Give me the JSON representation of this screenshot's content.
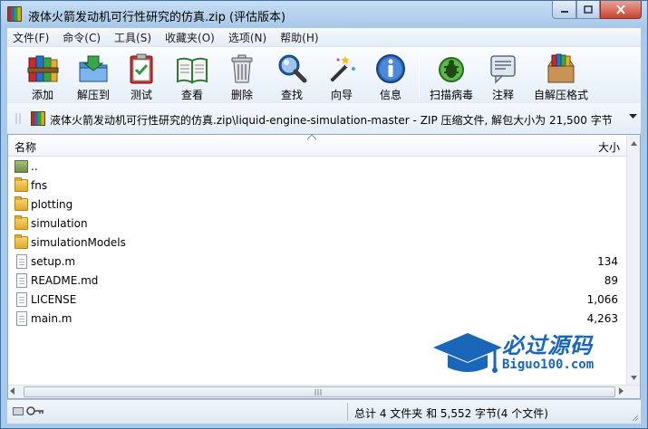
{
  "window": {
    "title": "液体火箭发动机可行性研究的仿真.zip (评估版本)"
  },
  "menu": [
    "文件(F)",
    "命令(C)",
    "工具(S)",
    "收藏夹(O)",
    "选项(N)",
    "帮助(H)"
  ],
  "toolbar": [
    {
      "label": "添加",
      "icon": "books-add-icon"
    },
    {
      "label": "解压到",
      "icon": "folder-extract-icon"
    },
    {
      "label": "测试",
      "icon": "clipboard-check-icon"
    },
    {
      "label": "查看",
      "icon": "book-view-icon"
    },
    {
      "label": "删除",
      "icon": "trash-icon"
    },
    {
      "label": "查找",
      "icon": "magnifier-icon"
    },
    {
      "label": "向导",
      "icon": "wand-icon"
    },
    {
      "label": "信息",
      "icon": "info-icon"
    },
    {
      "label": "扫描病毒",
      "icon": "bug-scan-icon"
    },
    {
      "label": "注释",
      "icon": "comment-icon"
    },
    {
      "label": "自解压格式",
      "icon": "sfx-box-icon"
    }
  ],
  "pathbar": {
    "text": "液体火箭发动机可行性研究的仿真.zip\\liquid-engine-simulation-master - ZIP 压缩文件, 解包大小为 21,500 字节"
  },
  "columns": {
    "name": "名称",
    "size": "大小"
  },
  "files": [
    {
      "name": "..",
      "type": "up",
      "size": ""
    },
    {
      "name": "fns",
      "type": "folder",
      "size": ""
    },
    {
      "name": "plotting",
      "type": "folder",
      "size": ""
    },
    {
      "name": "simulation",
      "type": "folder",
      "size": ""
    },
    {
      "name": "simulationModels",
      "type": "folder",
      "size": ""
    },
    {
      "name": "setup.m",
      "type": "file",
      "size": "134"
    },
    {
      "name": "README.md",
      "type": "file",
      "size": "89"
    },
    {
      "name": "LICENSE",
      "type": "file",
      "size": "1,066"
    },
    {
      "name": "main.m",
      "type": "file",
      "size": "4,263"
    }
  ],
  "status": {
    "summary": "总计 4 文件夹 和 5,552 字节(4 个文件)"
  },
  "watermark": {
    "title": "必过源码",
    "url": "Biguo100.com"
  }
}
